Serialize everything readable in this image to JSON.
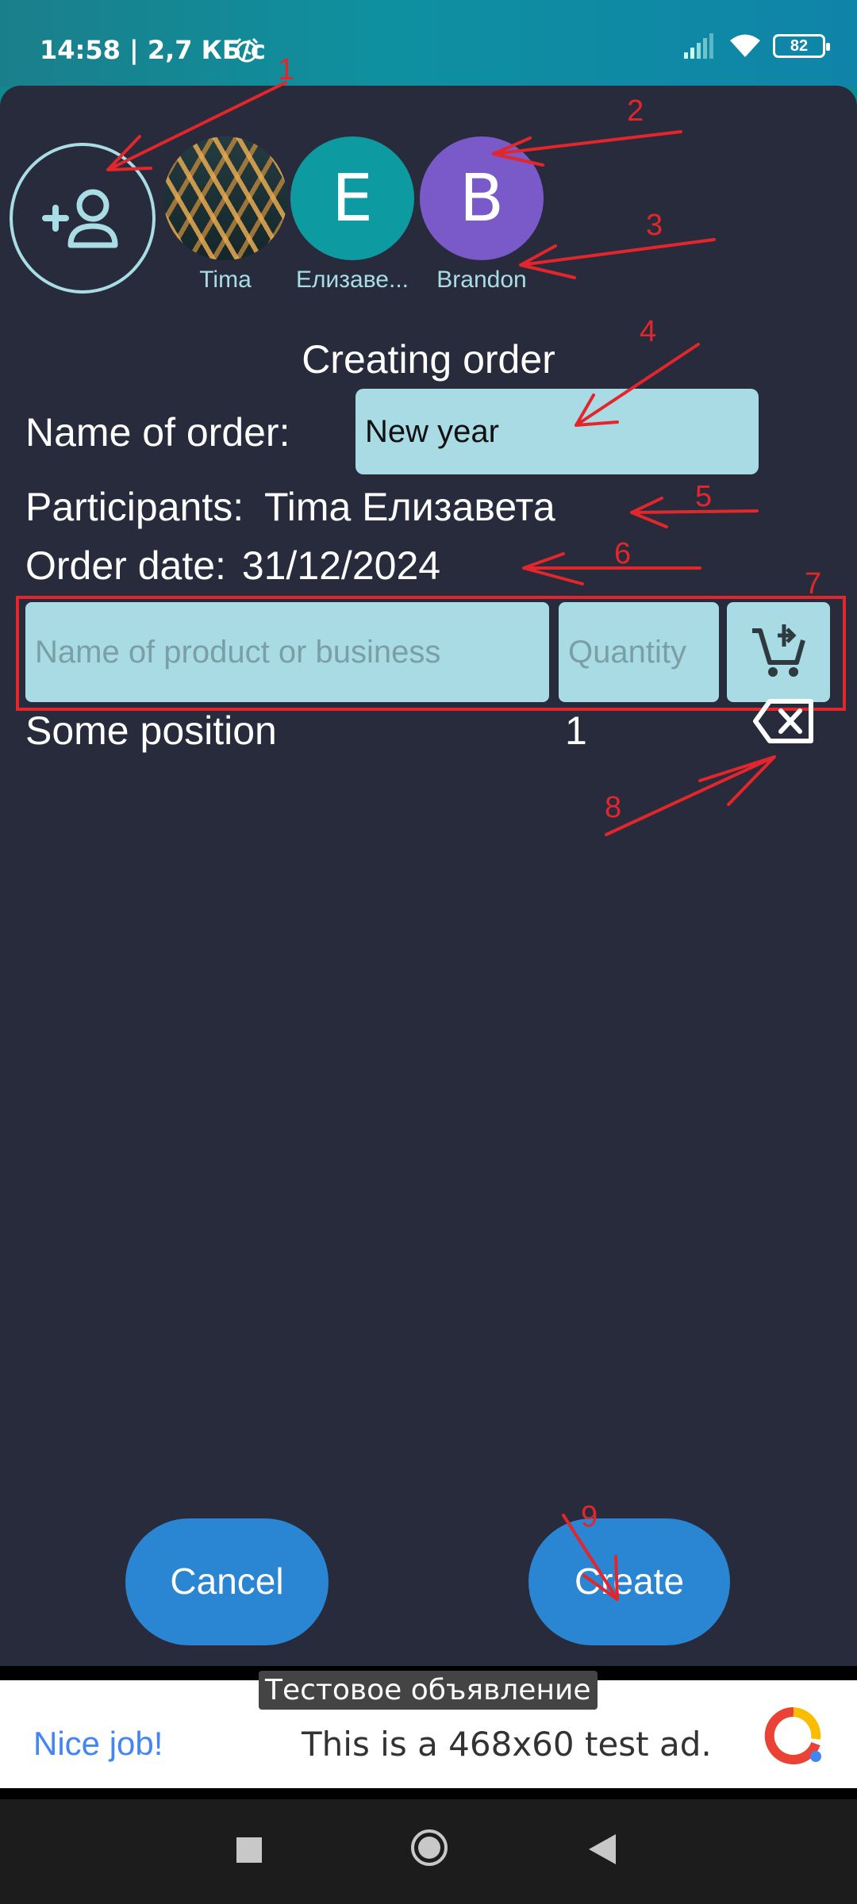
{
  "status_bar": {
    "time": "14:58 | 2,7 КБ/с",
    "battery": "82",
    "icons": [
      "alarm-icon",
      "signal-icon",
      "wifi-icon",
      "battery-icon"
    ]
  },
  "participants_bar": {
    "add_icon": "add-person-icon",
    "avatars": [
      {
        "name": "Tima",
        "initial": "",
        "type": "photo",
        "color": "#2a3d40"
      },
      {
        "name": "Елизаве...",
        "initial": "E",
        "type": "letter",
        "color": "#0e9aa1"
      },
      {
        "name": "Brandon",
        "initial": "B",
        "type": "letter",
        "color": "#7a59c8"
      }
    ]
  },
  "form": {
    "title": "Creating order",
    "name_label": "Name of order:",
    "name_value": "New year",
    "participants_label": "Participants:",
    "participants_value": "Tima Елизавета",
    "date_label": "Order date:",
    "date_value": "31/12/2024"
  },
  "product_entry": {
    "name_placeholder": "Name of product or business",
    "quantity_placeholder": "Quantity",
    "add_icon": "add-to-cart-icon"
  },
  "positions": [
    {
      "name": "Some position",
      "quantity": "1",
      "delete_icon": "backspace-icon"
    }
  ],
  "buttons": {
    "cancel": "Cancel",
    "create": "Create"
  },
  "ad": {
    "badge": "Тестовое объявление",
    "headline": "Nice job!",
    "text": "This is a 468x60 test ad."
  },
  "nav_bar": {
    "icons": [
      "recents-icon",
      "home-icon",
      "back-icon"
    ]
  },
  "annotations": {
    "color": "#e2262c",
    "labels": [
      "1",
      "2",
      "3",
      "4",
      "5",
      "6",
      "7",
      "8",
      "9"
    ]
  }
}
